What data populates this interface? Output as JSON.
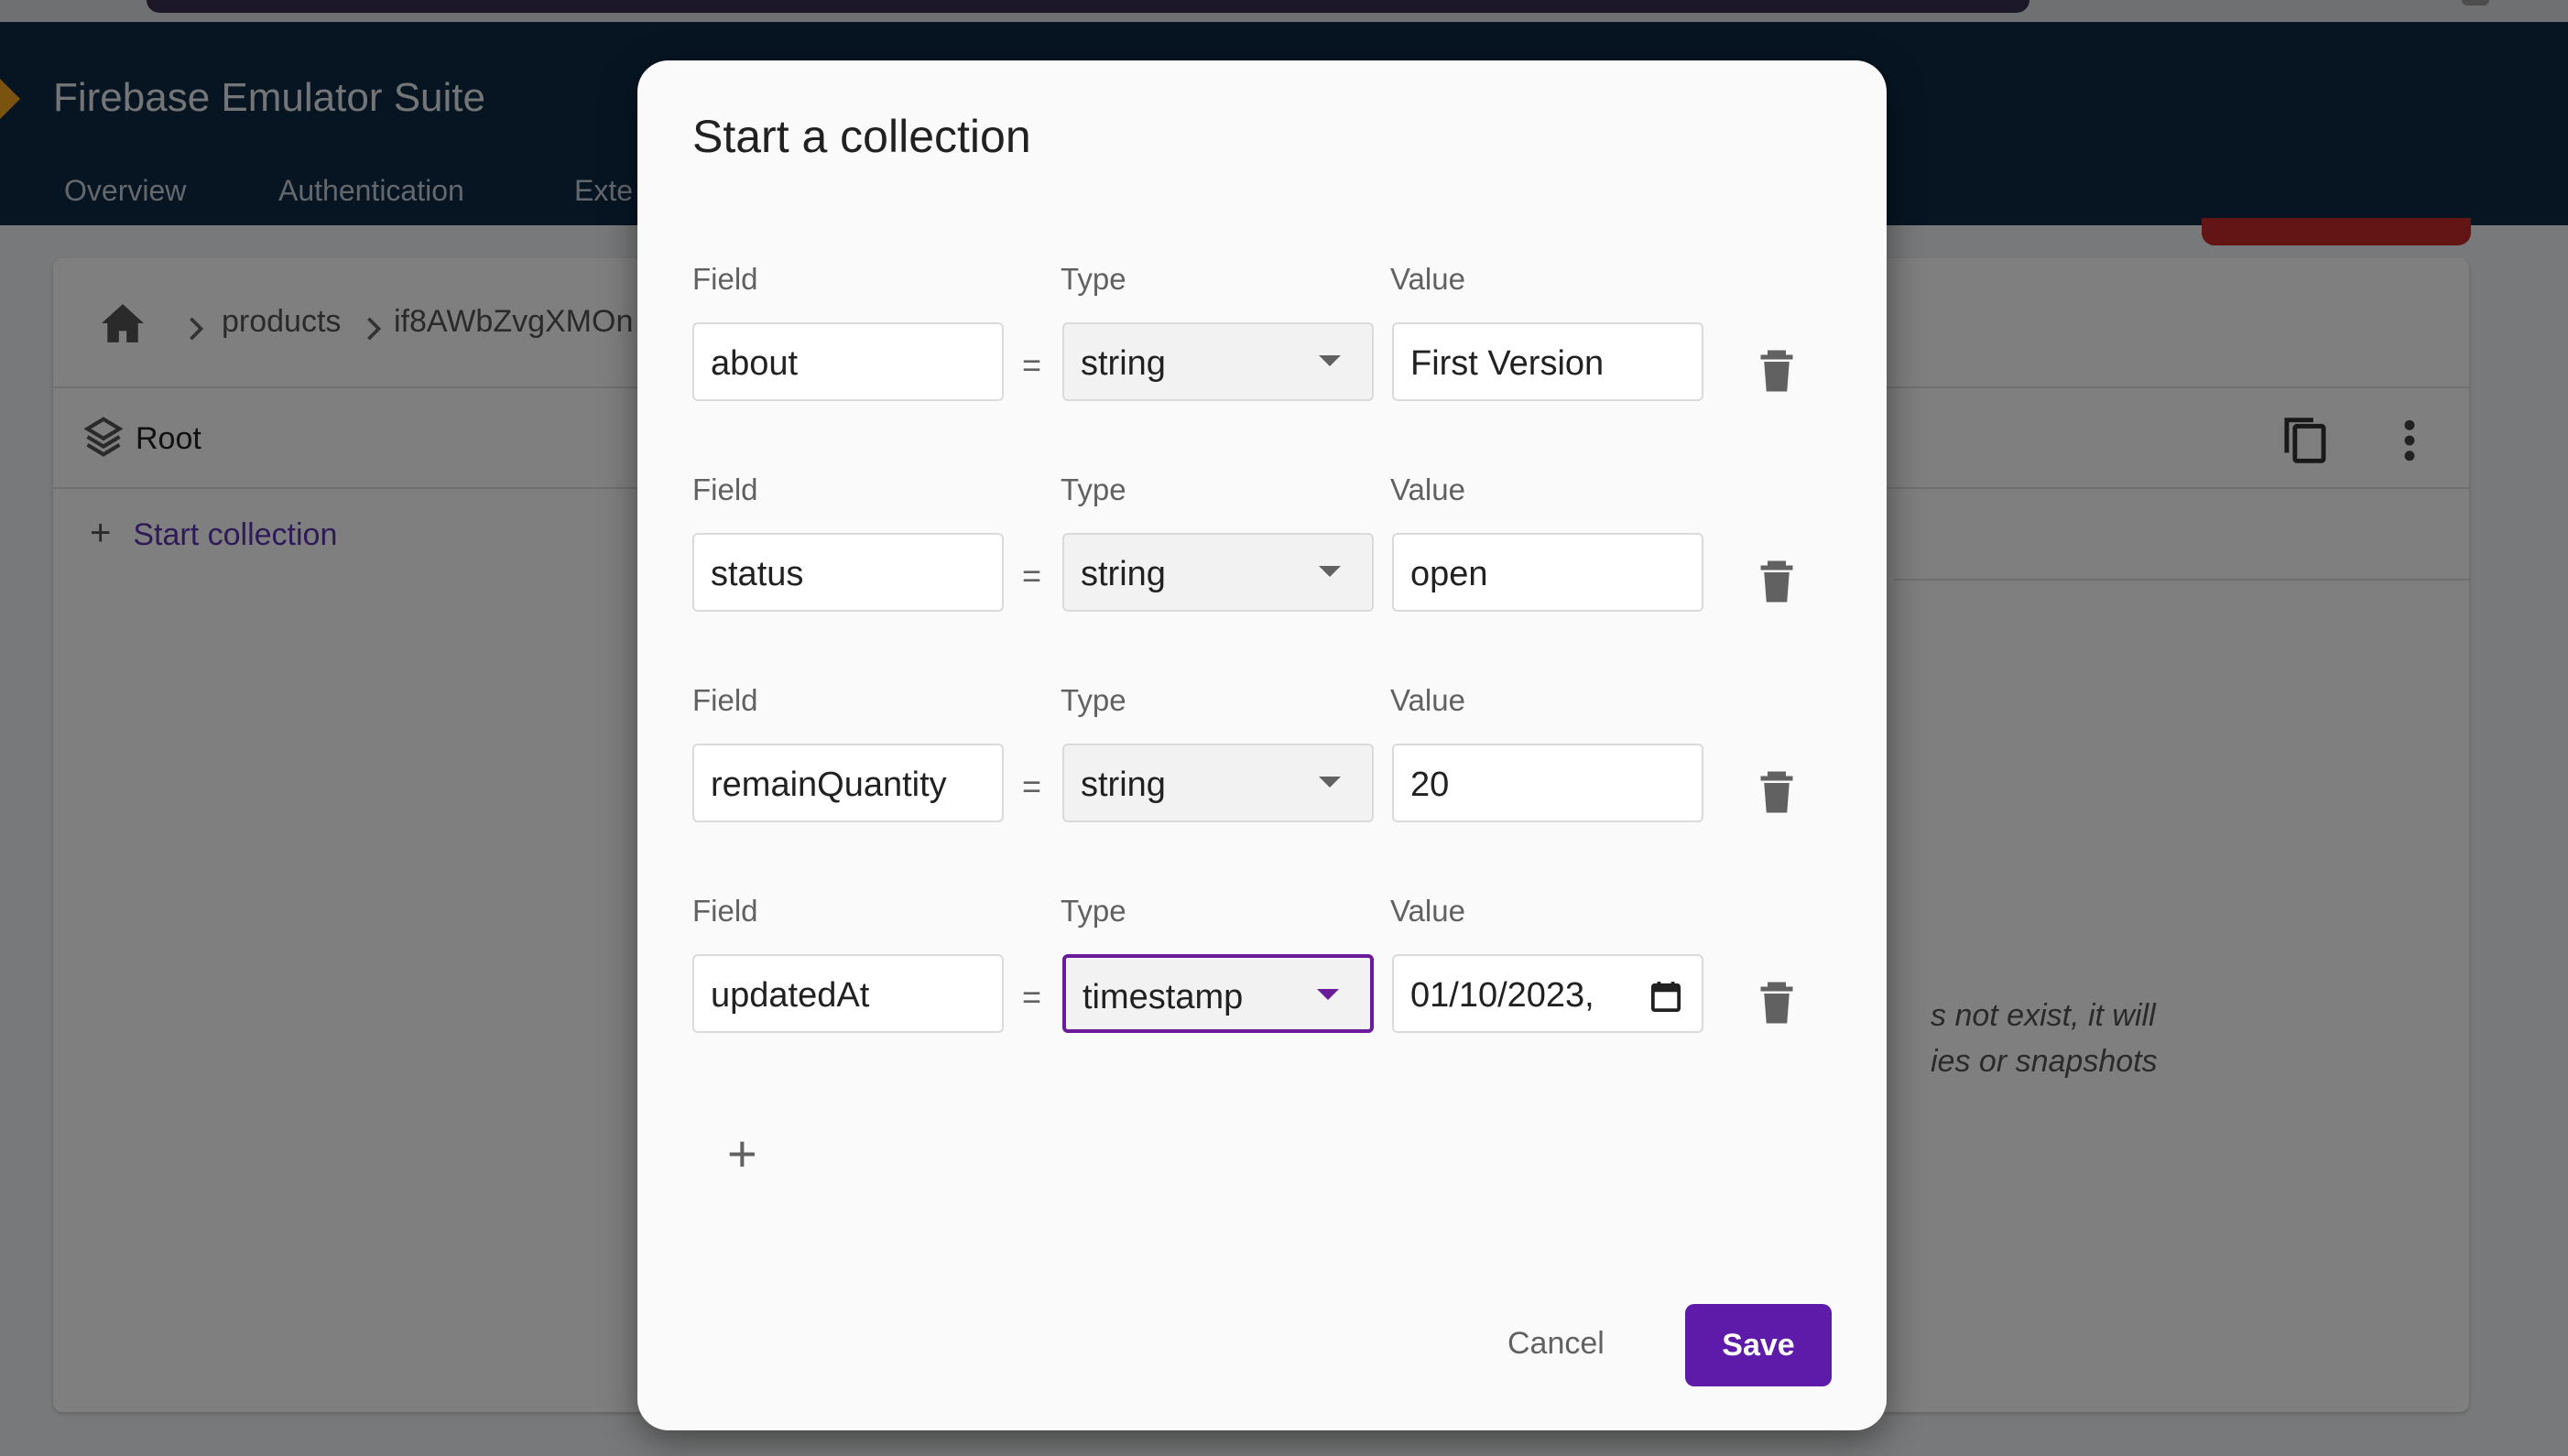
{
  "app": {
    "title": "Firebase Emulator Suite",
    "nav": [
      "Overview",
      "Authentication",
      "Exte"
    ]
  },
  "background": {
    "breadcrumb": [
      "products",
      "if8AWbZvgXMOn"
    ],
    "root_label": "Root",
    "start_collection_label": "Start collection",
    "hint_lines": [
      "s not exist, it will",
      "ies or snapshots"
    ]
  },
  "dialog": {
    "title": "Start a collection",
    "field_label": "Field",
    "type_label": "Type",
    "value_label": "Value",
    "equals": "=",
    "rows": [
      {
        "field": "about",
        "type": "string",
        "value": "First Version"
      },
      {
        "field": "status",
        "type": "string",
        "value": "open"
      },
      {
        "field": "remainQuantity",
        "type": "string",
        "value": "20"
      },
      {
        "field": "updatedAt",
        "type": "timestamp",
        "value": "01/10/2023,"
      }
    ],
    "add_icon": "+",
    "cancel_label": "Cancel",
    "save_label": "Save"
  },
  "colors": {
    "topbar": "#0e2a47",
    "accent": "#5e1aa8",
    "danger": "#c62828"
  }
}
